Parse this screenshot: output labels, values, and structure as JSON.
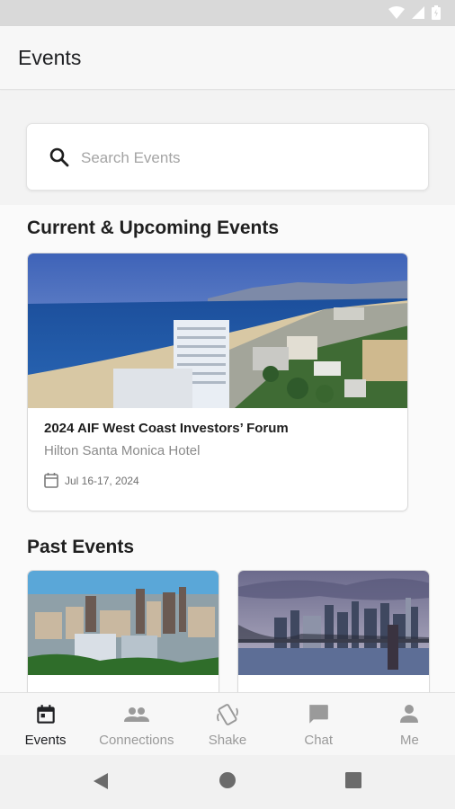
{
  "app": {
    "title": "Events"
  },
  "search": {
    "placeholder": "Search Events"
  },
  "sections": {
    "current_title": "Current & Upcoming Events",
    "past_title": "Past Events"
  },
  "current_event": {
    "title": "2024 AIF West Coast Investors’ Forum",
    "venue": "Hilton Santa Monica Hotel",
    "date": "Jul 16-17, 2024"
  },
  "bottom_nav": {
    "items": [
      {
        "label": "Events",
        "icon": "calendar-icon",
        "active": true
      },
      {
        "label": "Connections",
        "icon": "people-icon",
        "active": false
      },
      {
        "label": "Shake",
        "icon": "shake-phone-icon",
        "active": false
      },
      {
        "label": "Chat",
        "icon": "chat-bubble-icon",
        "active": false
      },
      {
        "label": "Me",
        "icon": "person-icon",
        "active": false
      }
    ]
  },
  "colors": {
    "active": "#202124",
    "inactive": "#9a9a9a",
    "accent_sky": "#4a6fc0"
  }
}
